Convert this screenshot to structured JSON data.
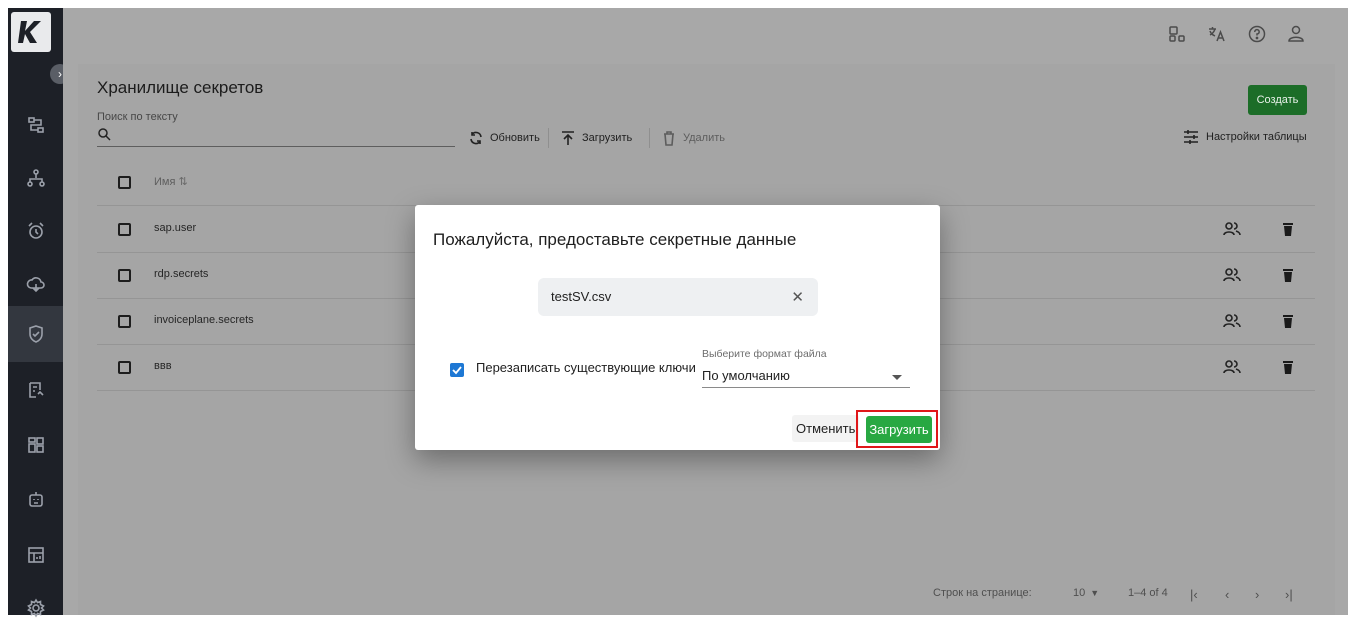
{
  "app": {
    "logo_letter": "K"
  },
  "header": {
    "icons": [
      "apps-icon",
      "translate-icon",
      "help-icon",
      "user-icon"
    ]
  },
  "sidebar": {
    "items": [
      {
        "icon": "flow-icon"
      },
      {
        "icon": "hierarchy-icon"
      },
      {
        "icon": "alarm-icon"
      },
      {
        "icon": "cloud-icon"
      },
      {
        "icon": "shield-icon",
        "active": true
      },
      {
        "icon": "list-icon"
      },
      {
        "icon": "grid-icon"
      },
      {
        "icon": "robot-icon"
      },
      {
        "icon": "dashboard-icon"
      },
      {
        "icon": "settings-icon"
      }
    ]
  },
  "page": {
    "title": "Хранилище секретов",
    "search_label": "Поиск по тексту",
    "create_label": "Создать",
    "toolbar": {
      "refresh_label": "Обновить",
      "upload_label": "Загрузить",
      "delete_label": "Удалить",
      "table_settings_label": "Настройки таблицы"
    },
    "table": {
      "name_header": "Имя",
      "sort_icon": "sort-icon",
      "rows": [
        {
          "name": "sap.user"
        },
        {
          "name": "rdp.secrets"
        },
        {
          "name": "invoiceplane.secrets"
        },
        {
          "name": "ввв"
        }
      ]
    },
    "pager": {
      "rows_per_page_label": "Строк на странице:",
      "rows_per_page_value": "10",
      "range": "1–4 of 4"
    }
  },
  "modal": {
    "title": "Пожалуйста, предоставьте секретные данные",
    "file_name": "testSV.csv",
    "overwrite_label": "Перезаписать существующие ключи",
    "overwrite_checked": true,
    "format_label": "Выберите формат файла",
    "format_value": "По умолчанию",
    "cancel_label": "Отменить",
    "upload_label": "Загрузить"
  },
  "colors": {
    "primary_green": "#28a842",
    "highlight_red": "#e0171a",
    "checkbox_blue": "#1e78d4",
    "sidebar_bg": "#1d2027"
  }
}
